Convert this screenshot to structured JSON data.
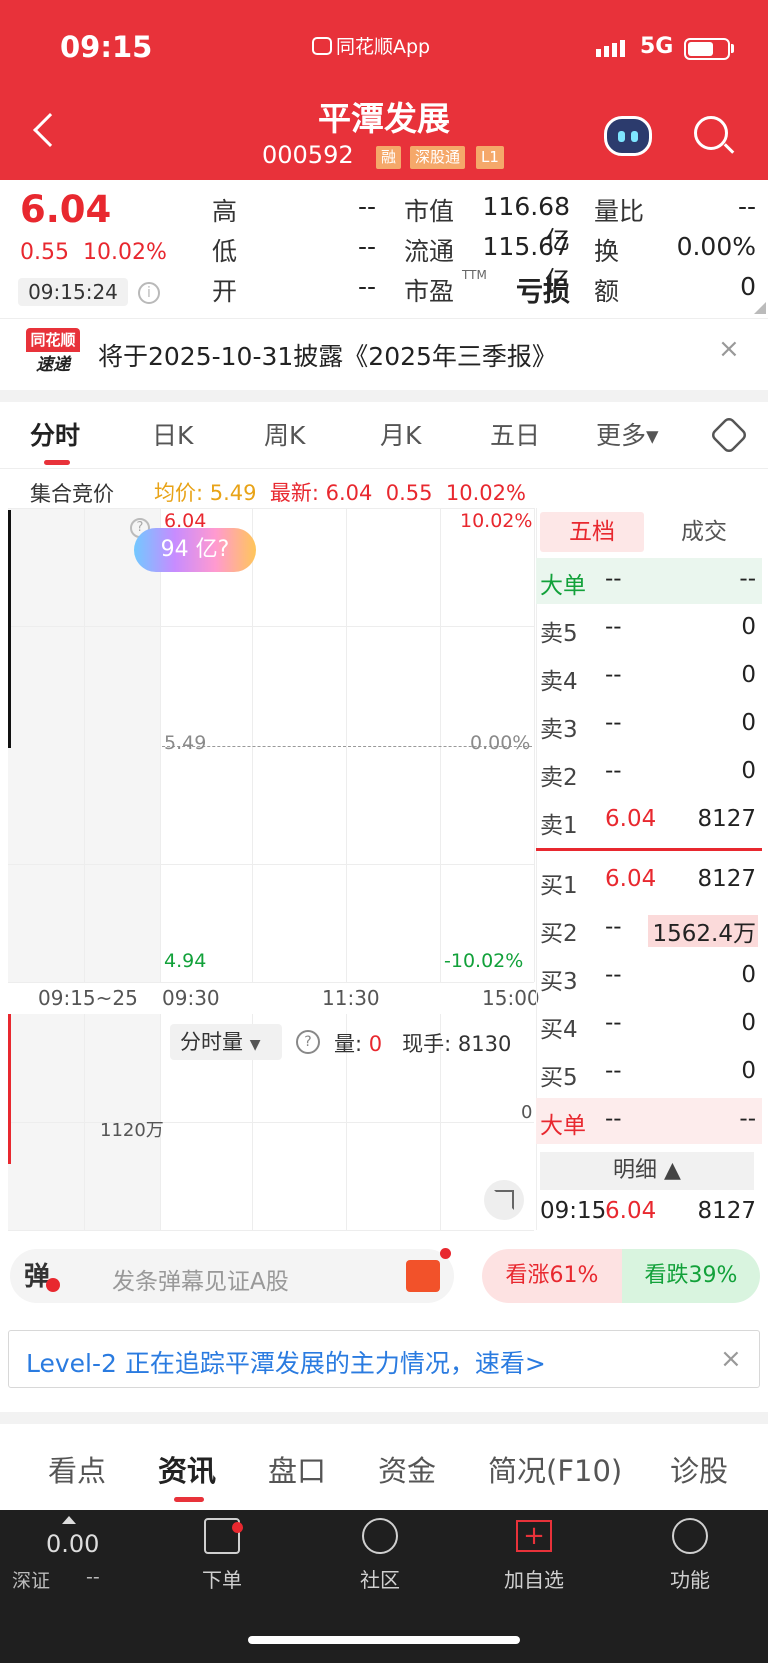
{
  "status_bar": {
    "time": "09:15",
    "app": "同花顺App",
    "network": "5G"
  },
  "header": {
    "name": "平潭发展",
    "code": "000592",
    "tags": [
      "融",
      "深股通",
      "L1"
    ]
  },
  "quote": {
    "price": "6.04",
    "change": "0.55",
    "change_pct": "10.02%",
    "time": "09:15:24",
    "fields": {
      "high_label": "高",
      "high": "--",
      "low_label": "低",
      "low": "--",
      "open_label": "开",
      "open": "--",
      "mktcap_label": "市值",
      "mktcap": "116.68亿",
      "float_label": "流通",
      "float": "115.67亿",
      "pe_label": "市盈",
      "pe_sup": "TTM",
      "pe": "亏损",
      "volratio_label": "量比",
      "volratio": "--",
      "turnover_label": "换",
      "turnover": "0.00%",
      "amount_label": "额",
      "amount": "0"
    }
  },
  "notice": {
    "logo_top": "同花顺",
    "logo_bottom": "速递",
    "text": "将于2025-10-31披露《2025年三季报》",
    "close": "×"
  },
  "chart_tabs": [
    "分时",
    "日K",
    "周K",
    "月K",
    "五日",
    "更多▾"
  ],
  "auction": {
    "label": "集合竞价",
    "avg": "均价: 5.49",
    "latest": "最新: 6.04",
    "chg": "0.55",
    "pct": "10.02%"
  },
  "chart": {
    "top_price": "6.04",
    "top_pct": "10.02%",
    "mid_price": "5.49",
    "mid_pct": "0.00%",
    "bottom_price": "4.94",
    "bottom_pct": "-10.02%",
    "ai_bubble": "94 亿?",
    "help": "?",
    "time_axis": [
      "09:15~25",
      "09:30",
      "11:30",
      "15:00"
    ]
  },
  "volume": {
    "selector": "分时量",
    "help": "?",
    "vol_label": "量: ",
    "vol_value": "0",
    "now_hand": "现手: 8130",
    "max_label": "1120万",
    "zero_label": "0"
  },
  "order_book": {
    "tab_active": "五档",
    "tab_other": "成交",
    "big_sell": {
      "label": "大单",
      "price": "--",
      "vol": "--"
    },
    "sells": [
      {
        "label": "卖5",
        "price": "--",
        "vol": "0"
      },
      {
        "label": "卖4",
        "price": "--",
        "vol": "0"
      },
      {
        "label": "卖3",
        "price": "--",
        "vol": "0"
      },
      {
        "label": "卖2",
        "price": "--",
        "vol": "0"
      },
      {
        "label": "卖1",
        "price": "6.04",
        "vol": "8127"
      }
    ],
    "buys": [
      {
        "label": "买1",
        "price": "6.04",
        "vol": "8127"
      },
      {
        "label": "买2",
        "price": "--",
        "vol": "1562.4万"
      },
      {
        "label": "买3",
        "price": "--",
        "vol": "0"
      },
      {
        "label": "买4",
        "price": "--",
        "vol": "0"
      },
      {
        "label": "买5",
        "price": "--",
        "vol": "0"
      }
    ],
    "big_buy": {
      "label": "大单",
      "price": "--",
      "vol": "--"
    },
    "detail_label": "明细 ▲",
    "detail_row": {
      "time": "09:15",
      "price": "6.04",
      "vol": "8127"
    }
  },
  "danmu": {
    "icon": "弹",
    "placeholder": "发条弹幕见证A股",
    "bull": "看涨61%",
    "bear": "看跌39%"
  },
  "level2": {
    "text": "Level-2 正在追踪平潭发展的主力情况，速看>",
    "close": "×"
  },
  "bottom_tabs": [
    "看点",
    "资讯",
    "盘口",
    "资金",
    "简况(F10)",
    "诊股"
  ],
  "bottom_bar": {
    "index_value": "0.00",
    "index_name": "深证",
    "index_chg": "--",
    "items": [
      "下单",
      "社区",
      "加自选",
      "功能"
    ]
  },
  "colors": {
    "brand": "#e8323a",
    "up": "#e8282f",
    "down": "#12a13a",
    "link": "#2a7be0"
  }
}
